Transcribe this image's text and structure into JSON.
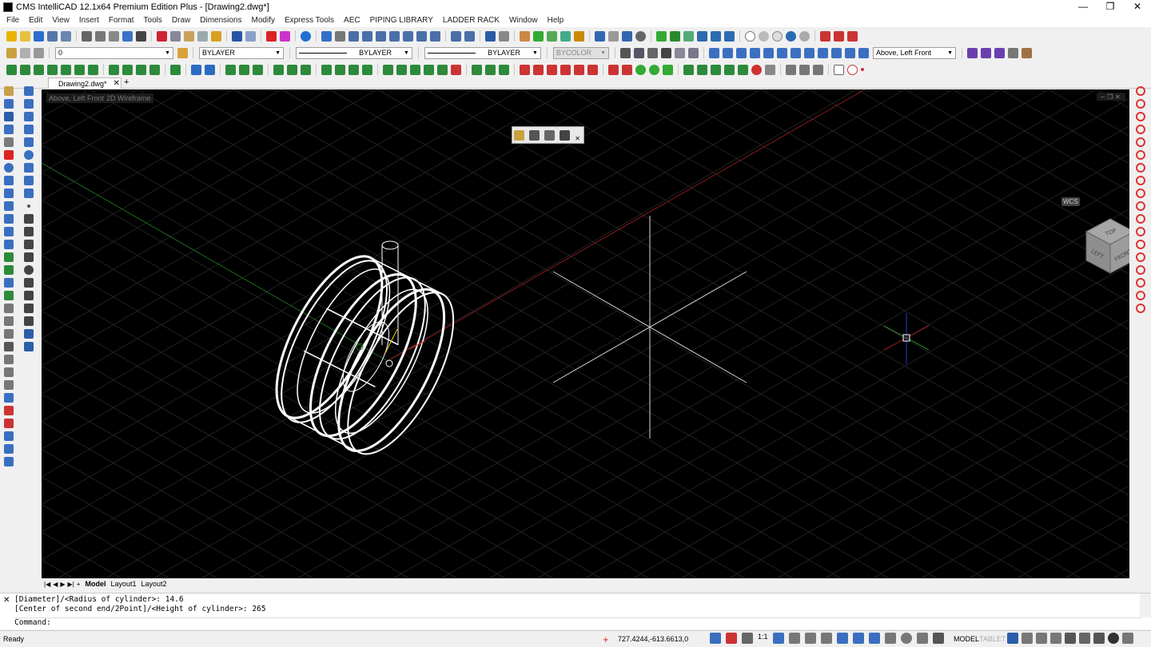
{
  "window": {
    "title": "CMS IntelliCAD 12.1x64 Premium Edition Plus - [Drawing2.dwg*]",
    "minimize": "—",
    "maximize": "❐",
    "close": "✕"
  },
  "menu": [
    "File",
    "Edit",
    "View",
    "Insert",
    "Format",
    "Tools",
    "Draw",
    "Dimensions",
    "Modify",
    "Express Tools",
    "AEC",
    "PIPING LIBRARY",
    "LADDER RACK",
    "Window",
    "Help"
  ],
  "properties": {
    "layer": "0",
    "color": "BYLAYER",
    "linetype": "BYLAYER",
    "lineweight": "BYLAYER",
    "plotstyle": "BYCOLOR",
    "view": "Above, Left Front"
  },
  "document_tab": {
    "label": "Drawing2.dwg*",
    "close": "✕",
    "add": "+"
  },
  "viewport": {
    "view_label": "Above, Left Front",
    "style_label": "2D Wireframe",
    "viewcube": {
      "top": "TOP",
      "left": "LEFT",
      "front": "FRONT"
    },
    "wcs_label": "WCS"
  },
  "layout_tabs": [
    "Model",
    "Layout1",
    "Layout2"
  ],
  "command": {
    "lines": [
      "[Diameter]/<Radius of cylinder>: 14.6",
      "[Center of second end/2Point]/<Height of cylinder>: 265",
      "Command:"
    ]
  },
  "status": {
    "ready": "Ready",
    "coordinates": "727.4244,-613.6613,0",
    "scale": "1:1",
    "model": "MODEL",
    "tablet": "TABLET"
  },
  "colors": {
    "viewport_bg": "#000000",
    "grid": "#2e2e2e",
    "x_axis": "#8b1a1a",
    "y_axis": "#1d6b1d",
    "geometry": "#ffffff"
  }
}
